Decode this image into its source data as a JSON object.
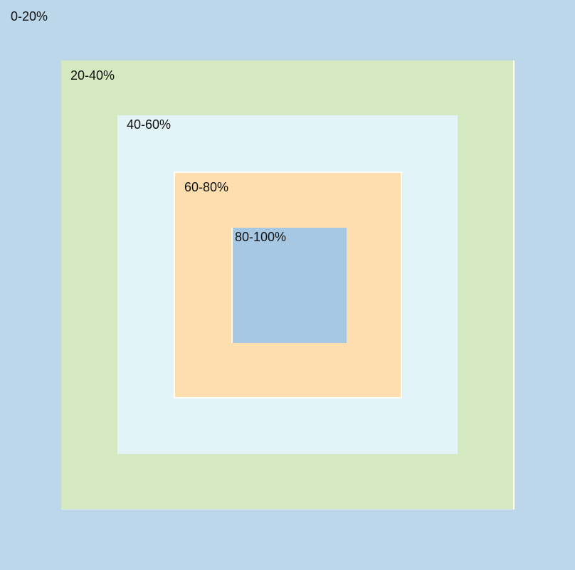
{
  "zones": [
    {
      "label": "0-20%",
      "color": "#bdd7ea"
    },
    {
      "label": "20-40%",
      "color": "#d5e9c0"
    },
    {
      "label": "40-60%",
      "color": "#e2f4f8"
    },
    {
      "label": "60-80%",
      "color": "#fddeae"
    },
    {
      "label": "80-100%",
      "color": "#a7c8e2"
    }
  ]
}
